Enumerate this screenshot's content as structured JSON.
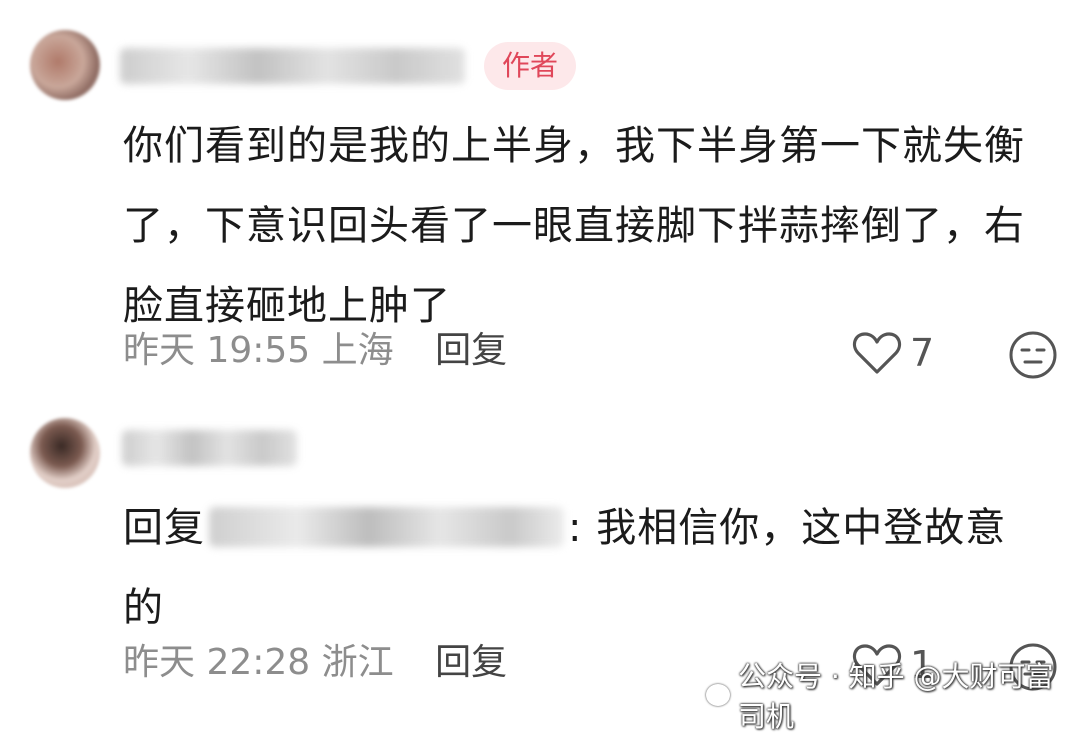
{
  "comments": [
    {
      "author_badge": "作者",
      "text": "你们看到的是我的上半身，我下半身第一下就失衡了，下意识回头看了一眼直接脚下拌蒜摔倒了，右脸直接砸地上肿了",
      "time": "昨天 19:55",
      "location": "上海",
      "reply_label": "回复",
      "likes": "7"
    },
    {
      "reply_prefix": "回复",
      "text": ": 我相信你，这中登故意的",
      "time": "昨天 22:28",
      "location": "浙江",
      "reply_label": "回复",
      "likes": "1"
    }
  ],
  "watermark": "公众号 · 知乎 @大财可富司机",
  "icons": {
    "like": "heart-outline-icon",
    "reaction": "neutral-face-icon",
    "watermark": "wechat-icon"
  },
  "colors": {
    "badge_bg": "#fde8ea",
    "badge_text": "#e0475a",
    "meta_text": "#8d8d8d"
  }
}
